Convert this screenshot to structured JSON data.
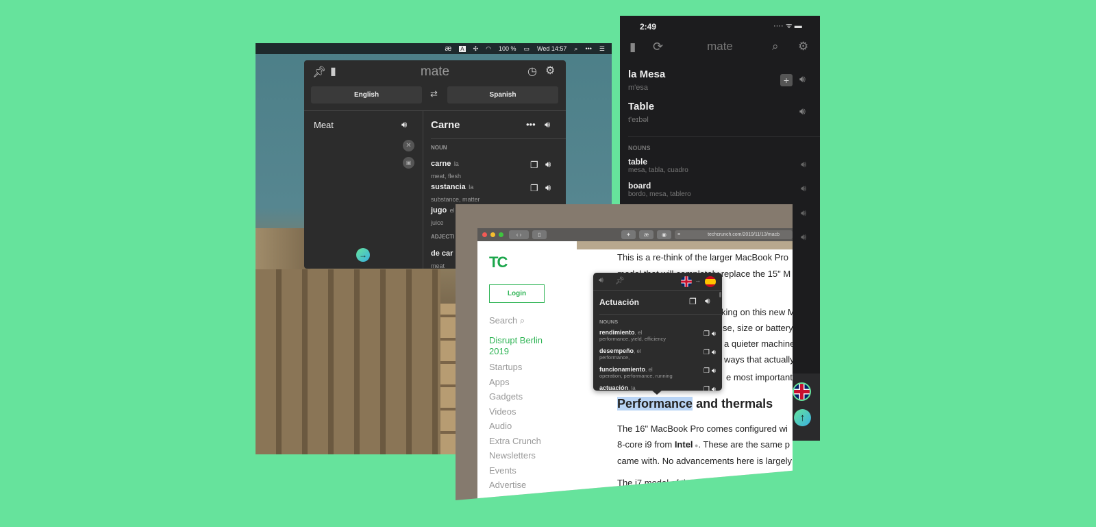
{
  "colors": {
    "background": "#66e39c",
    "accent": "#3ecf8e",
    "tc_green": "#0a9e01"
  },
  "desktop": {
    "menubar": {
      "app_icon": "æ",
      "input_icon": "A",
      "battery": "100 %",
      "clock": "Wed 14:57"
    },
    "mate": {
      "title": "mate",
      "source_lang": "English",
      "target_lang": "Spanish",
      "input": "Meat",
      "result": "Carne",
      "section1": "NOUN",
      "entries": [
        {
          "word": "carne",
          "gender": "la",
          "trans": "meat, flesh"
        },
        {
          "word": "sustancia",
          "gender": "la",
          "trans": "substance, matter"
        },
        {
          "word": "jugo",
          "gender": "el",
          "trans": "juice"
        }
      ],
      "section2": "ADJECTI",
      "adj_entry": {
        "word": "de car",
        "trans": "meat"
      }
    }
  },
  "phone": {
    "time": "2:49",
    "title": "mate",
    "word": "la Mesa",
    "word_phon": "m'esa",
    "translation": "Table",
    "trans_phon": "t'eɪbəl",
    "section": "NOUNS",
    "entries": [
      {
        "word": "table",
        "trans": "mesa, tabla, cuadro"
      },
      {
        "word": "board",
        "trans": "bordo, mesa, tablero"
      }
    ]
  },
  "browser": {
    "url": "techcrunch.com/2019/11/13/macb",
    "toolbar_icon": "æ",
    "logo": "TC",
    "login": "Login",
    "search": "Search",
    "nav": [
      "Disrupt Berlin 2019",
      "Startups",
      "Apps",
      "Gadgets",
      "Videos",
      "Audio",
      "Extra Crunch",
      "Newsletters",
      "Events",
      "Advertise"
    ],
    "article": {
      "lines_top": [
        "This is a re-think of the larger MacBook Pro",
        "model that will completely replace the 15\" M"
      ],
      "lines_mid": [
        "king on this new M",
        "se, size or battery",
        "a quieter machine",
        "ways that actually",
        "e most important"
      ],
      "heading_highlight": "Performance",
      "heading_rest": " and thermals",
      "p1": "The 16\" MacBook Pro comes configured wi",
      "p2a": "8-core i9 from ",
      "p2b": "Intel",
      "p2c": ". These are the same p",
      "p3": "came with. No advancements here is largely",
      "p4": "The i7 model of the 16\""
    },
    "popup": {
      "word": "Actuación",
      "section": "NOUNS",
      "entries": [
        {
          "word": "rendimiento",
          "gender": ", el",
          "trans": "performance, yield, efficiency"
        },
        {
          "word": "desempeño",
          "gender": ", el",
          "trans": "performance,"
        },
        {
          "word": "funcionamiento",
          "gender": ", el",
          "trans": "operation, performance, running"
        },
        {
          "word": "actuación",
          "gender": ", la",
          "trans": ""
        }
      ]
    }
  }
}
